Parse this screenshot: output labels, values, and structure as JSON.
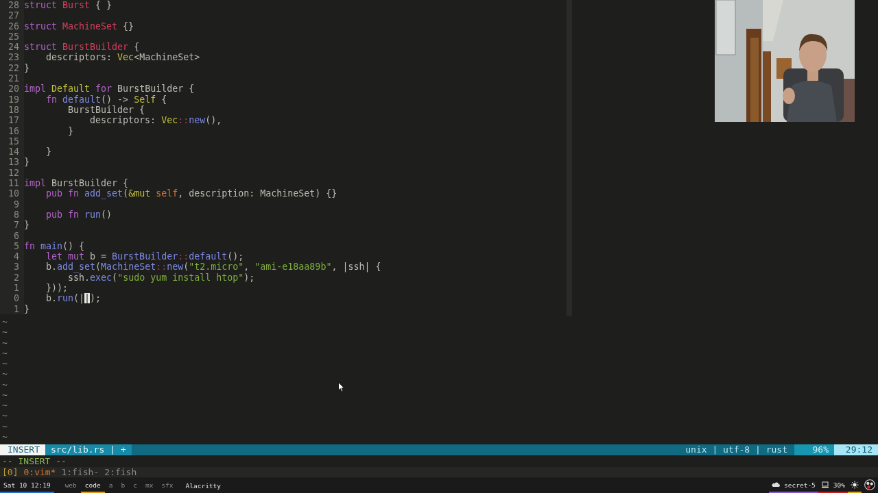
{
  "editor": {
    "lines": [
      {
        "number": "28",
        "tokens": [
          {
            "text": "struct ",
            "kind": "keyword"
          },
          {
            "text": "Burst",
            "kind": "type"
          },
          {
            "text": " { }",
            "kind": "plain"
          }
        ]
      },
      {
        "number": "27"
      },
      {
        "number": "26",
        "tokens": [
          {
            "text": "struct ",
            "kind": "keyword"
          },
          {
            "text": "MachineSet",
            "kind": "type"
          },
          {
            "text": " {}",
            "kind": "plain"
          }
        ]
      },
      {
        "number": "25"
      },
      {
        "number": "24",
        "tokens": [
          {
            "text": "struct ",
            "kind": "keyword"
          },
          {
            "text": "BurstBuilder",
            "kind": "type"
          },
          {
            "text": " {",
            "kind": "plain"
          }
        ]
      },
      {
        "number": "23",
        "tokens": [
          {
            "text": "    descriptors: ",
            "kind": "plain"
          },
          {
            "text": "Vec",
            "kind": "builtin"
          },
          {
            "text": "<MachineSet>",
            "kind": "plain"
          }
        ]
      },
      {
        "number": "22",
        "tokens": [
          {
            "text": "}",
            "kind": "plain"
          }
        ]
      },
      {
        "number": "21"
      },
      {
        "number": "20",
        "tokens": [
          {
            "text": "impl ",
            "kind": "keyword"
          },
          {
            "text": "Default ",
            "kind": "builtin"
          },
          {
            "text": "for",
            "kind": "keyword"
          },
          {
            "text": " BurstBuilder {",
            "kind": "plain"
          }
        ]
      },
      {
        "number": "19",
        "tokens": [
          {
            "text": "    fn ",
            "kind": "keyword"
          },
          {
            "text": "default",
            "kind": "function"
          },
          {
            "text": "() -> ",
            "kind": "plain"
          },
          {
            "text": "Self",
            "kind": "builtin"
          },
          {
            "text": " {",
            "kind": "plain"
          }
        ]
      },
      {
        "number": "18",
        "tokens": [
          {
            "text": "        BurstBuilder {",
            "kind": "plain"
          }
        ]
      },
      {
        "number": "17",
        "tokens": [
          {
            "text": "            descriptors: ",
            "kind": "plain"
          },
          {
            "text": "Vec",
            "kind": "builtin"
          },
          {
            "text": "::",
            "kind": "separator"
          },
          {
            "text": "new",
            "kind": "function"
          },
          {
            "text": "(),",
            "kind": "plain"
          }
        ]
      },
      {
        "number": "16",
        "tokens": [
          {
            "text": "        }",
            "kind": "plain"
          }
        ]
      },
      {
        "number": "15"
      },
      {
        "number": "14",
        "tokens": [
          {
            "text": "    }",
            "kind": "plain"
          }
        ]
      },
      {
        "number": "13",
        "tokens": [
          {
            "text": "}",
            "kind": "plain"
          }
        ]
      },
      {
        "number": "12"
      },
      {
        "number": "11",
        "tokens": [
          {
            "text": "impl",
            "kind": "keyword"
          },
          {
            "text": " BurstBuilder {",
            "kind": "plain"
          }
        ]
      },
      {
        "number": "10",
        "tokens": [
          {
            "text": "    pub fn ",
            "kind": "keyword"
          },
          {
            "text": "add_set",
            "kind": "function"
          },
          {
            "text": "(",
            "kind": "plain"
          },
          {
            "text": "&mut ",
            "kind": "builtin"
          },
          {
            "text": "self",
            "kind": "self"
          },
          {
            "text": ", description: MachineSet) {}",
            "kind": "plain"
          }
        ]
      },
      {
        "number": "9"
      },
      {
        "number": "8",
        "tokens": [
          {
            "text": "    pub fn ",
            "kind": "keyword"
          },
          {
            "text": "run",
            "kind": "function"
          },
          {
            "text": "()",
            "kind": "plain"
          }
        ]
      },
      {
        "number": "7",
        "tokens": [
          {
            "text": "}",
            "kind": "plain"
          }
        ]
      },
      {
        "number": "6"
      },
      {
        "number": "5",
        "tokens": [
          {
            "text": "fn ",
            "kind": "keyword"
          },
          {
            "text": "main",
            "kind": "function"
          },
          {
            "text": "() {",
            "kind": "plain"
          }
        ]
      },
      {
        "number": "4",
        "tokens": [
          {
            "text": "    let mut",
            "kind": "keyword"
          },
          {
            "text": " b = ",
            "kind": "plain"
          },
          {
            "text": "BurstBuilder",
            "kind": "function"
          },
          {
            "text": "::",
            "kind": "separator"
          },
          {
            "text": "default",
            "kind": "function"
          },
          {
            "text": "();",
            "kind": "plain"
          }
        ]
      },
      {
        "number": "3",
        "tokens": [
          {
            "text": "    b.",
            "kind": "plain"
          },
          {
            "text": "add_set",
            "kind": "function"
          },
          {
            "text": "(",
            "kind": "plain"
          },
          {
            "text": "MachineSet",
            "kind": "function"
          },
          {
            "text": "::",
            "kind": "separator"
          },
          {
            "text": "new",
            "kind": "function"
          },
          {
            "text": "(",
            "kind": "plain"
          },
          {
            "text": "\"t2.micro\"",
            "kind": "string"
          },
          {
            "text": ", ",
            "kind": "plain"
          },
          {
            "text": "\"ami-e18aa89b\"",
            "kind": "string"
          },
          {
            "text": ", |ssh| {",
            "kind": "plain"
          }
        ]
      },
      {
        "number": "2",
        "tokens": [
          {
            "text": "        ssh.",
            "kind": "plain"
          },
          {
            "text": "exec",
            "kind": "function"
          },
          {
            "text": "(",
            "kind": "plain"
          },
          {
            "text": "\"sudo yum install htop\"",
            "kind": "string"
          },
          {
            "text": ");",
            "kind": "plain"
          }
        ]
      },
      {
        "number": "1",
        "tokens": [
          {
            "text": "    }));",
            "kind": "plain"
          }
        ]
      },
      {
        "number": "0",
        "tokens": [
          {
            "text": "    b.",
            "kind": "plain"
          },
          {
            "text": "run",
            "kind": "function"
          },
          {
            "text": "(|",
            "kind": "plain"
          },
          {
            "text": "|",
            "kind": "cursor"
          },
          {
            "text": ");",
            "kind": "plain"
          }
        ]
      },
      {
        "number": "1",
        "tokens": [
          {
            "text": "}",
            "kind": "plain"
          }
        ]
      }
    ],
    "empty_lines": [
      "~",
      "~",
      "~",
      "~",
      "~",
      "~",
      "~",
      "~",
      "~",
      "~",
      "~",
      "~"
    ]
  },
  "statusline": {
    "mode": "INSERT",
    "file": "src/lib.rs | +",
    "info": "unix | utf-8 | rust",
    "percent": "96%",
    "position": "29:12"
  },
  "message": "-- INSERT --",
  "tmux": {
    "session": "[0]",
    "windows": [
      {
        "label": "0:vim*",
        "selected": true
      },
      {
        "label": "1:fish-",
        "selected": false
      },
      {
        "label": "2:fish",
        "selected": false
      }
    ]
  },
  "taskbar": {
    "clock": "Sat 10 12:19",
    "workspaces": [
      {
        "label": "web",
        "selected": false
      },
      {
        "label": "code",
        "selected": true
      },
      {
        "label": "a",
        "selected": false
      },
      {
        "label": "b",
        "selected": false
      },
      {
        "label": "c",
        "selected": false
      },
      {
        "label": "mx",
        "selected": false
      },
      {
        "label": "sfx",
        "selected": false
      }
    ],
    "window_title": "Alacritty",
    "tray": [
      {
        "kind": "cloud",
        "label": "secret-5",
        "color": "#8a5cc8"
      },
      {
        "kind": "laptop",
        "label": "30%",
        "color": "#c42020"
      },
      {
        "kind": "sun",
        "color": "#e0a020"
      },
      {
        "kind": "record"
      }
    ]
  }
}
